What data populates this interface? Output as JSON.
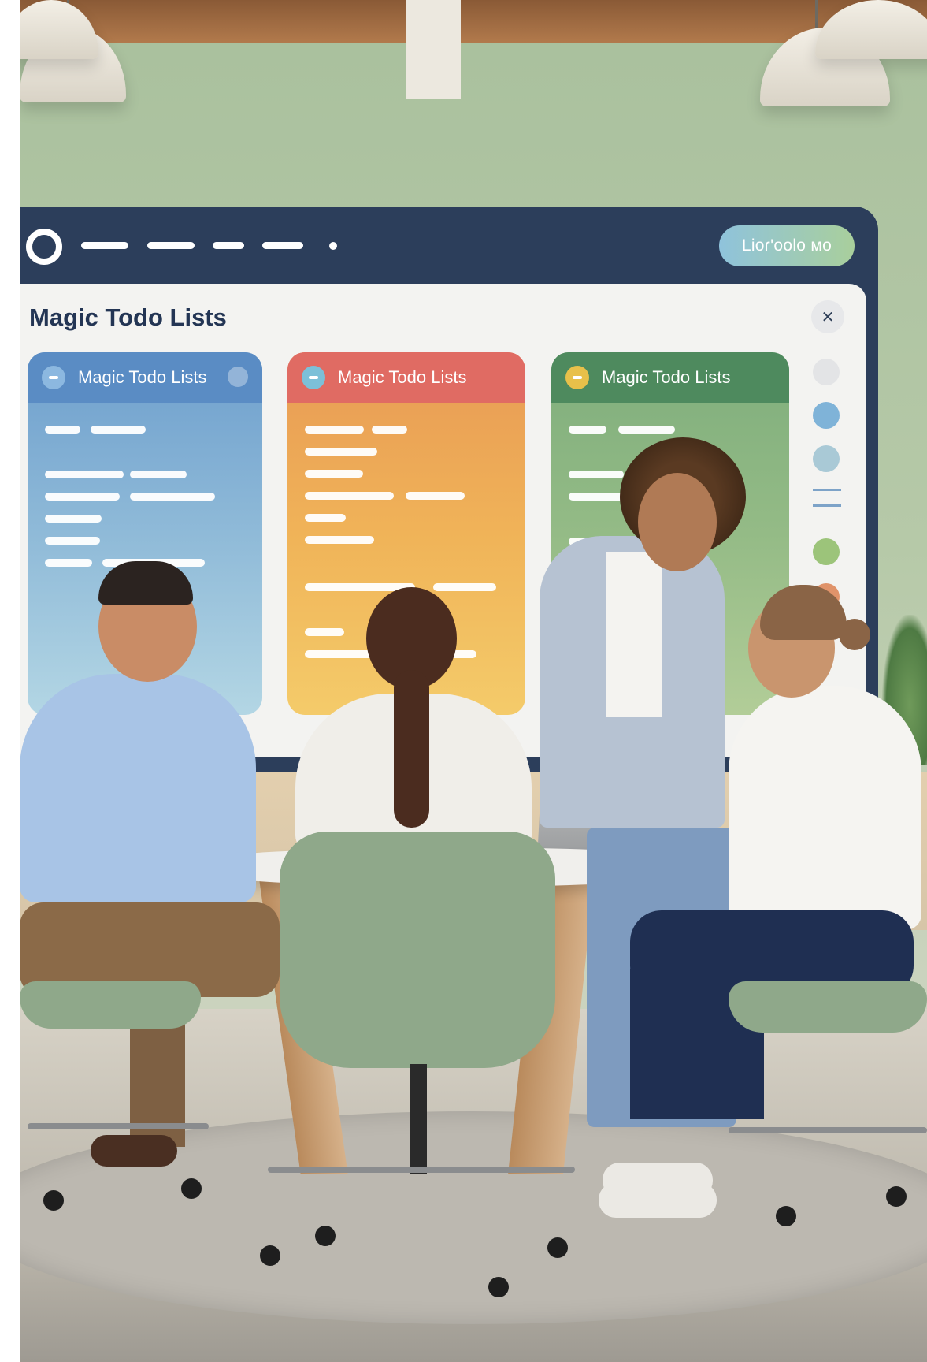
{
  "screen": {
    "cta_label": "Lioɾ'oolo мо",
    "panel_title": "Magic Todo Lists",
    "close_symbol": "✕",
    "columns": [
      {
        "title": "Magic Todo Lists",
        "accent": "#5b8fc7",
        "icon_color": "#8cb8e0"
      },
      {
        "title": "Magic Todo Lists",
        "accent": "#e06b63",
        "icon_color": "#7cc0d8"
      },
      {
        "title": "Magic Todo Lists",
        "accent": "#4e8a5e",
        "icon_color": "#e8c04a"
      }
    ],
    "side_dot_colors": [
      "#e3e4e6",
      "#7fb3d8",
      "#a9c9d6",
      "#9cc47a",
      "#e0936a"
    ]
  },
  "colors": {
    "wall": "#b3c7a5",
    "screen_frame": "#2c3e5b",
    "chair": "#8fa88a"
  }
}
